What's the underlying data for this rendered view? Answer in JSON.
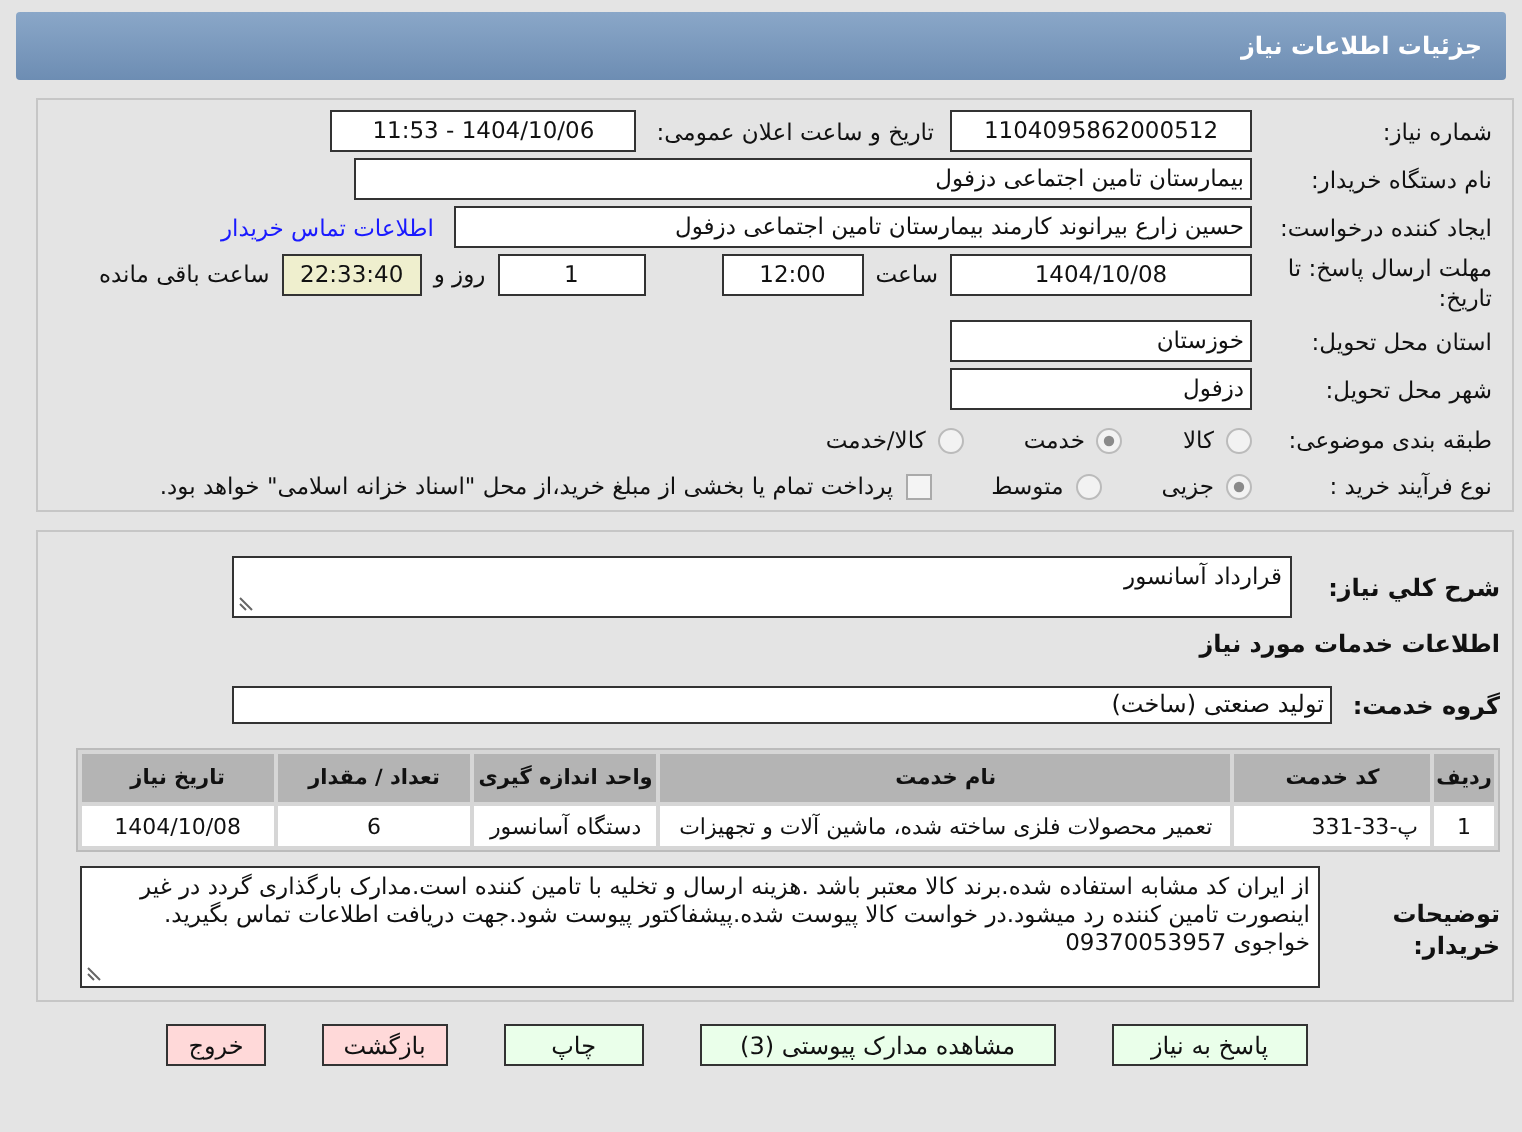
{
  "header": {
    "title": "جزئیات اطلاعات نیاز"
  },
  "need_number": {
    "label": "شماره نیاز:",
    "value": "1104095862000512"
  },
  "announce": {
    "label": "تاریخ و ساعت اعلان عمومی:",
    "value": "1404/10/06 - 11:53"
  },
  "buyer_org": {
    "label": "نام دستگاه خریدار:",
    "value": "بیمارستان تامین اجتماعی دزفول"
  },
  "requester": {
    "label": "ایجاد کننده درخواست:",
    "value": "حسین زارع بیرانوند کارمند بیمارستان تامین اجتماعی دزفول",
    "link": "اطلاعات تماس خریدار"
  },
  "deadline": {
    "label": "مهلت ارسال پاسخ: تا تاریخ:",
    "date": "1404/10/08",
    "time_label": "ساعت",
    "time": "12:00",
    "days": "1",
    "days_label": "روز و",
    "remaining": "22:33:40",
    "remaining_label": "ساعت باقی مانده"
  },
  "province": {
    "label": "استان محل تحویل:",
    "value": "خوزستان"
  },
  "city": {
    "label": "شهر محل تحویل:",
    "value": "دزفول"
  },
  "category": {
    "label": "طبقه بندی موضوعی:",
    "options": [
      {
        "label": "کالا",
        "selected": false
      },
      {
        "label": "خدمت",
        "selected": true
      },
      {
        "label": "کالا/خدمت",
        "selected": false
      }
    ]
  },
  "process": {
    "label": "نوع فرآیند خرید :",
    "options": [
      {
        "label": "جزیی",
        "selected": true
      },
      {
        "label": "متوسط",
        "selected": false
      }
    ],
    "checkbox": {
      "label": "پرداخت تمام یا بخشی از مبلغ خرید،از محل \"اسناد خزانه اسلامی\" خواهد بود.",
      "checked": false
    }
  },
  "summary": {
    "label": "شرح کلي نياز:",
    "value": "قرارداد آسانسور"
  },
  "services_title": "اطلاعات خدمات مورد نیاز",
  "service_group": {
    "label": "گروه خدمت:",
    "value": "تولید صنعتی (ساخت)"
  },
  "table": {
    "columns": [
      "ردیف",
      "کد خدمت",
      "نام خدمت",
      "واحد اندازه گیری",
      "تعداد / مقدار",
      "تاریخ نیاز"
    ],
    "rows": [
      [
        "1",
        "پ-33-331",
        "تعمیر محصولات فلزی ساخته شده، ماشین آلات و تجهیزات",
        "دستگاه آسانسور",
        "6",
        "1404/10/08"
      ]
    ]
  },
  "buyer_notes": {
    "label": "توضیحات خریدار:",
    "value": "از ایران کد مشابه استفاده شده.برند کالا معتبر باشد .هزینه ارسال و تخلیه با تامین کننده است.مدارک بارگذاری گردد در غیر اینصورت تامین کننده رد میشود.در خواست کالا پیوست شده.پیشفاکتور پیوست شود.جهت دریافت اطلاعات تماس بگیرید. خواجوی 09370053957"
  },
  "buttons": [
    {
      "label": "پاسخ به نیاز",
      "kind": "normal"
    },
    {
      "label": "مشاهده مدارک پیوستی (3)",
      "kind": "normal"
    },
    {
      "label": "چاپ",
      "kind": "normal"
    },
    {
      "label": "بازگشت",
      "kind": "danger"
    },
    {
      "label": "خروج",
      "kind": "danger"
    }
  ]
}
